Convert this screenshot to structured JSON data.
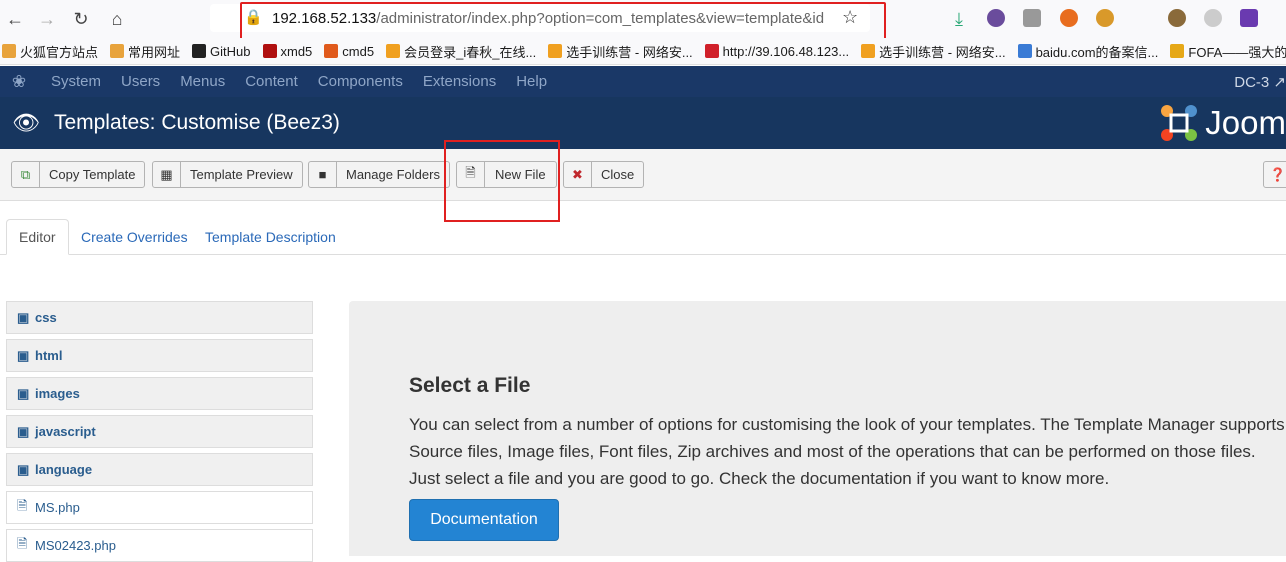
{
  "browser": {
    "url_host": "192.168.52.133",
    "url_path": "/administrator/index.php?option=com_templates&view=template&id"
  },
  "bookmarks": [
    {
      "label": "火狐官方站点",
      "icon": "folder-icon",
      "color": "#e8a33c"
    },
    {
      "label": "常用网址",
      "icon": "folder-icon",
      "color": "#e8a33c"
    },
    {
      "label": "GitHub",
      "icon": "github-icon",
      "color": "#222222"
    },
    {
      "label": "xmd5",
      "icon": "xmd5-icon",
      "color": "#b01010"
    },
    {
      "label": "cmd5",
      "icon": "cmd5-icon",
      "color": "#e05a1c"
    },
    {
      "label": "会员登录_i春秋_在线...",
      "icon": "ichunqiu-icon",
      "color": "#f0a020"
    },
    {
      "label": "选手训练营 - 网络安...",
      "icon": "ichunqiu-icon",
      "color": "#f0a020"
    },
    {
      "label": "http://39.106.48.123...",
      "icon": "z-icon",
      "color": "#d0202a"
    },
    {
      "label": "选手训练营 - 网络安...",
      "icon": "ichunqiu-icon",
      "color": "#f0a020"
    },
    {
      "label": "baidu.com的备案信...",
      "icon": "baidu-icon",
      "color": "#3a7bd5"
    },
    {
      "label": "FOFA——强大的",
      "icon": "fofa-icon",
      "color": "#e6a817"
    }
  ],
  "admin_menu": {
    "items": [
      "System",
      "Users",
      "Menus",
      "Content",
      "Components",
      "Extensions",
      "Help"
    ],
    "site_name": "DC-3"
  },
  "header": {
    "title": "Templates: Customise (Beez3)",
    "logo_text": "Joom"
  },
  "toolbar": {
    "copy_template": "Copy Template",
    "template_preview": "Template Preview",
    "manage_folders": "Manage Folders",
    "new_file": "New File",
    "close": "Close"
  },
  "tabs": [
    "Editor",
    "Create Overrides",
    "Template Description"
  ],
  "tree": {
    "folders": [
      "css",
      "html",
      "images",
      "javascript",
      "language"
    ],
    "files": [
      "MS.php",
      "MS02423.php"
    ]
  },
  "main": {
    "title": "Select a File",
    "text": "You can select from a number of options for customising the look of your templates. The Template Manager supports Source files, Image files, Font files, Zip archives and most of the operations that can be performed on those files. Just select a file and you are good to go. Check the documentation if you want to know more.",
    "button": "Documentation"
  },
  "colors": {
    "admin_menu_bg": "#1a3867",
    "header_bg": "#17365f",
    "primary_button": "#2384d3",
    "highlight_box": "#e02020"
  }
}
